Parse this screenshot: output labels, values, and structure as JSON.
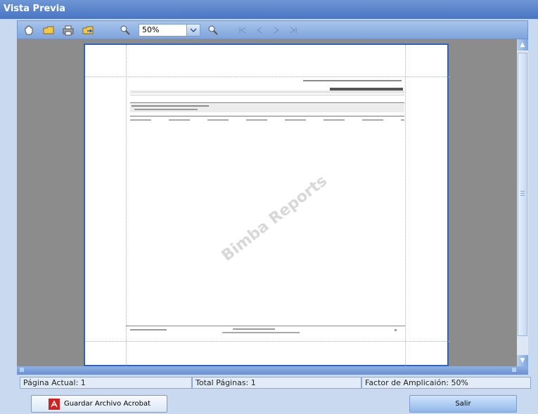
{
  "window": {
    "title": "Vista Previa"
  },
  "toolbar": {
    "zoom_value": "50%",
    "icons": [
      "hand-icon",
      "open-icon",
      "print-icon",
      "export-icon",
      "zoom-in-icon",
      "zoom-dropdown-icon",
      "zoom-out-icon",
      "first-page-icon",
      "prev-page-icon",
      "next-page-icon",
      "last-page-icon"
    ]
  },
  "document": {
    "watermark": "Bimba Reports"
  },
  "status": {
    "current_page": "Página Actual: 1",
    "total_pages": "Total Páginas: 1",
    "zoom_factor": "Factor de Amplicaión: 50%"
  },
  "buttons": {
    "save_pdf": "Guardar Archivo Acrobat",
    "exit": "Salir"
  },
  "colors": {
    "title_bar": "#4a76c2",
    "viewer_bg": "#8c8c8c",
    "page_border": "#2f62c8",
    "status_bg": "#e2ecf9"
  }
}
